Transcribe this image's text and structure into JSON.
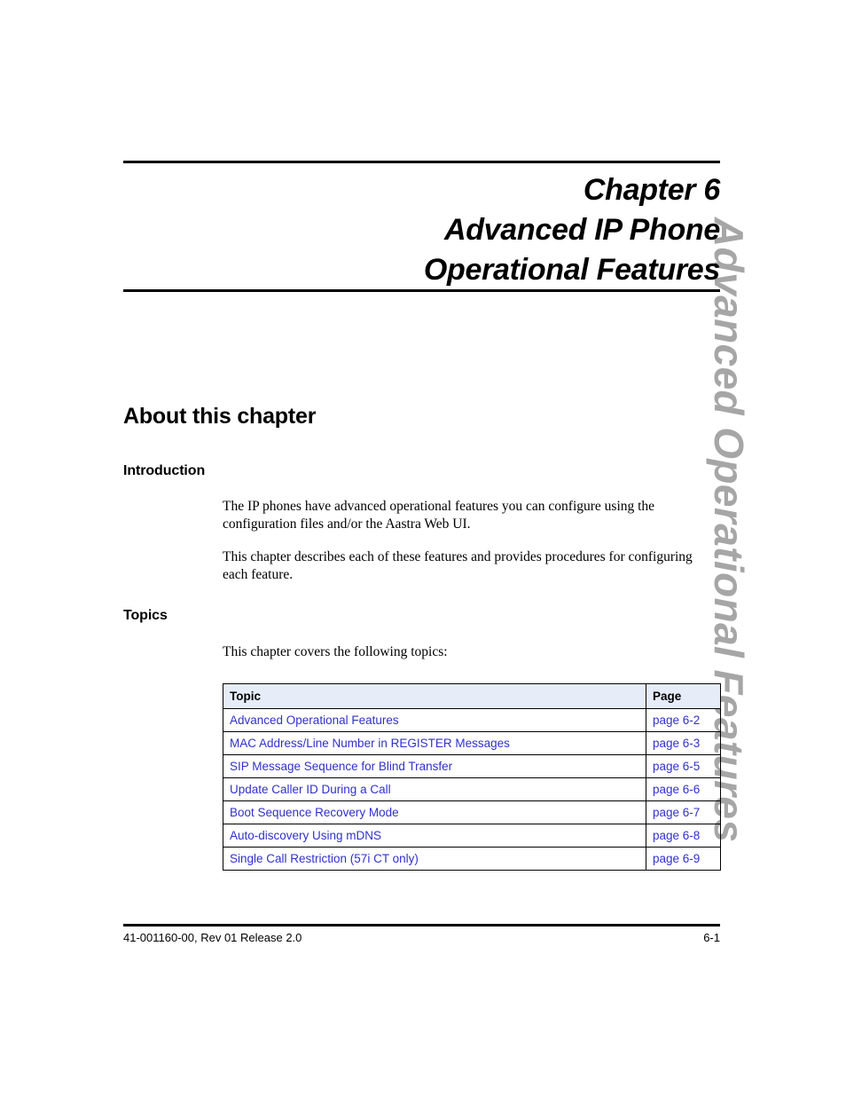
{
  "side_tab": {
    "label": "Advanced Operational Features",
    "color": "#a6a6a6"
  },
  "chapter": {
    "number_line": "Chapter 6",
    "title_line_1": "Advanced IP Phone",
    "title_line_2": "Operational Features"
  },
  "sections": {
    "about_heading": "About this chapter",
    "introduction_heading": "Introduction",
    "intro_paragraph_1": "The IP phones have advanced operational features you can configure using the configuration files and/or the Aastra Web UI.",
    "intro_paragraph_2": "This chapter describes each of these features and provides procedures for configuring each feature.",
    "topics_heading": "Topics",
    "topics_lead_in": "This chapter covers the following topics:"
  },
  "topics_table": {
    "header_background": "#e6ecf8",
    "link_color": "#3030cf",
    "columns": [
      "Topic",
      "Page"
    ],
    "rows": [
      {
        "topic": "Advanced Operational Features",
        "page": "page 6-2",
        "indent": false
      },
      {
        "topic": "MAC Address/Line Number in REGISTER Messages",
        "page": "page 6-3",
        "indent": true
      },
      {
        "topic": "SIP Message Sequence for Blind Transfer",
        "page": "page 6-5",
        "indent": true
      },
      {
        "topic": "Update Caller ID During a Call",
        "page": "page 6-6",
        "indent": true
      },
      {
        "topic": "Boot Sequence Recovery Mode",
        "page": "page 6-7",
        "indent": true
      },
      {
        "topic": "Auto-discovery Using mDNS",
        "page": "page 6-8",
        "indent": true
      },
      {
        "topic": "Single Call Restriction (57i CT only)",
        "page": "page 6-9",
        "indent": true
      }
    ]
  },
  "footer": {
    "left": "41-001160-00, Rev 01  Release 2.0",
    "right": "6-1"
  }
}
